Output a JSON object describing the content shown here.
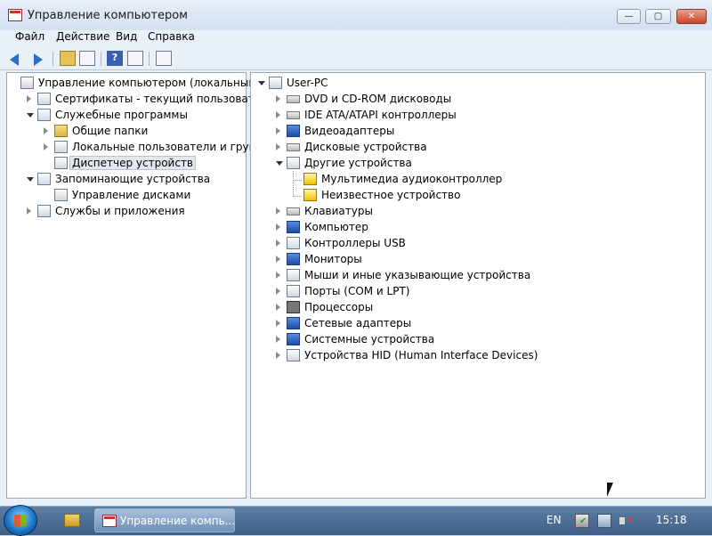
{
  "window": {
    "title": "Управление компьютером",
    "controls": {
      "minimize": "—",
      "maximize": "▢",
      "close": "✕"
    }
  },
  "menu": [
    "Файл",
    "Действие",
    "Вид",
    "Справка"
  ],
  "toolbar": {
    "icons": [
      "back-icon",
      "forward-icon",
      "up-folder-icon",
      "show-hide-tree-icon",
      "help-icon",
      "properties-icon",
      "scan-hardware-icon"
    ]
  },
  "left_tree": [
    {
      "label": "Управление компьютером (локальным)",
      "level": 0,
      "state": "none",
      "icon": "computer-management-icon"
    },
    {
      "label": "Сертификаты - текущий пользователь",
      "level": 1,
      "state": "collapsed",
      "icon": "certificates-icon"
    },
    {
      "label": "Служебные программы",
      "level": 1,
      "state": "expanded",
      "icon": "tools-icon"
    },
    {
      "label": "Общие папки",
      "level": 2,
      "state": "collapsed",
      "icon": "shared-folders-icon"
    },
    {
      "label": "Локальные пользователи и группы",
      "level": 2,
      "state": "collapsed",
      "icon": "users-icon"
    },
    {
      "label": "Диспетчер устройств",
      "level": 2,
      "state": "none",
      "icon": "device-manager-icon",
      "selected": true
    },
    {
      "label": "Запоминающие устройства",
      "level": 1,
      "state": "expanded",
      "icon": "storage-icon"
    },
    {
      "label": "Управление дисками",
      "level": 2,
      "state": "none",
      "icon": "disk-management-icon"
    },
    {
      "label": "Службы и приложения",
      "level": 1,
      "state": "collapsed",
      "icon": "services-icon"
    }
  ],
  "right_tree": {
    "root": {
      "label": "User-PC",
      "icon": "computer-icon"
    },
    "items": [
      {
        "label": "DVD и CD-ROM дисководы",
        "icon": "dvd-drive-icon",
        "state": "collapsed"
      },
      {
        "label": "IDE ATA/ATAPI контроллеры",
        "icon": "ide-controller-icon",
        "state": "collapsed"
      },
      {
        "label": "Видеоадаптеры",
        "icon": "video-adapter-icon",
        "state": "collapsed"
      },
      {
        "label": "Дисковые устройства",
        "icon": "disk-drive-icon",
        "state": "collapsed"
      },
      {
        "label": "Другие устройства",
        "icon": "other-devices-icon",
        "state": "expanded",
        "children": [
          {
            "label": "Мультимедиа аудиоконтроллер",
            "icon": "warning-device-icon"
          },
          {
            "label": "Неизвестное устройство",
            "icon": "warning-device-icon"
          }
        ]
      },
      {
        "label": "Клавиатуры",
        "icon": "keyboard-icon",
        "state": "collapsed"
      },
      {
        "label": "Компьютер",
        "icon": "computer-small-icon",
        "state": "collapsed"
      },
      {
        "label": "Контроллеры USB",
        "icon": "usb-icon",
        "state": "collapsed"
      },
      {
        "label": "Мониторы",
        "icon": "monitor-icon",
        "state": "collapsed"
      },
      {
        "label": "Мыши и иные указывающие устройства",
        "icon": "mouse-icon",
        "state": "collapsed"
      },
      {
        "label": "Порты (COM и LPT)",
        "icon": "port-icon",
        "state": "collapsed"
      },
      {
        "label": "Процессоры",
        "icon": "processor-icon",
        "state": "collapsed"
      },
      {
        "label": "Сетевые адаптеры",
        "icon": "network-adapter-icon",
        "state": "collapsed"
      },
      {
        "label": "Системные устройства",
        "icon": "system-devices-icon",
        "state": "collapsed"
      },
      {
        "label": "Устройства HID (Human Interface Devices)",
        "icon": "hid-icon",
        "state": "collapsed"
      }
    ]
  },
  "taskbar": {
    "task_label": "Управление компь...",
    "language": "EN",
    "clock": "15:18",
    "tray_icons": [
      "action-center-icon",
      "network-icon",
      "volume-muted-icon"
    ]
  }
}
